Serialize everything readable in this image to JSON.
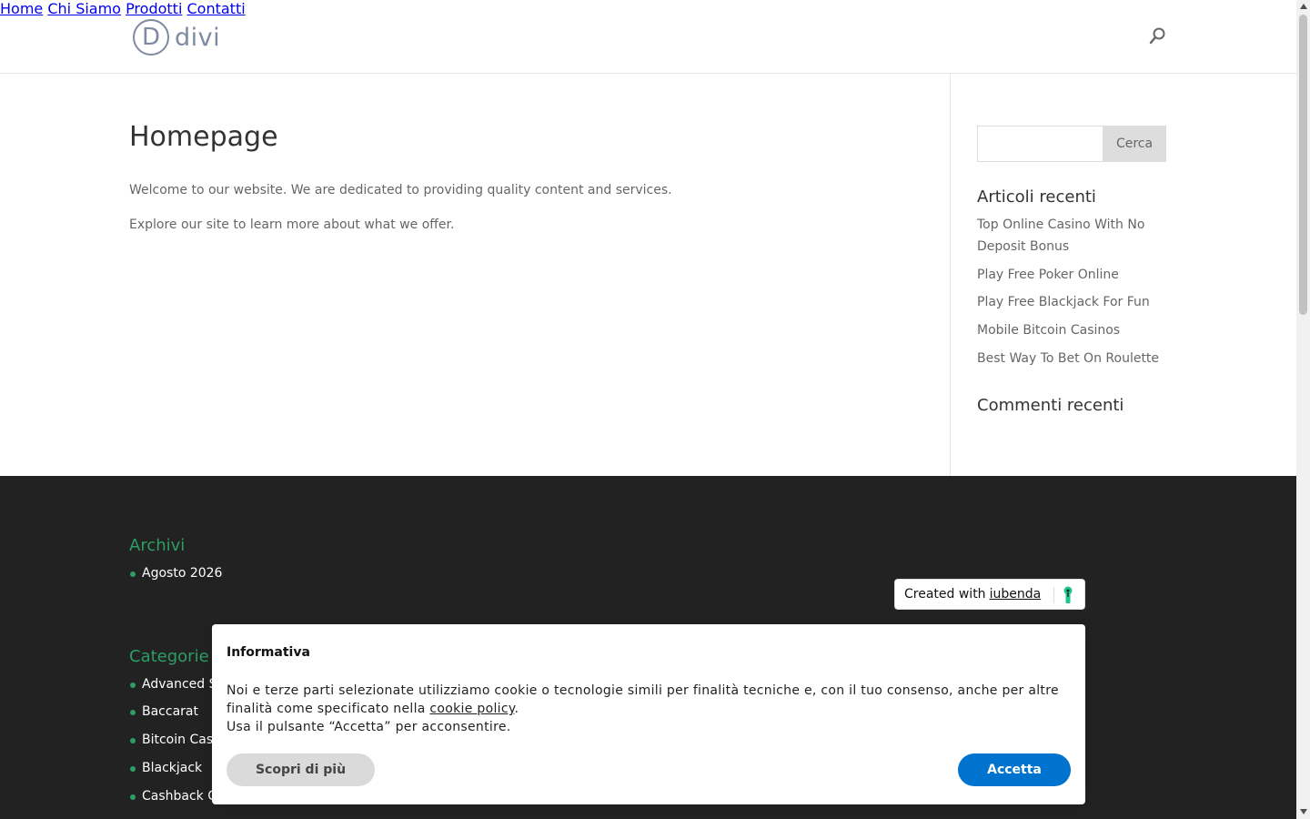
{
  "header": {
    "logo_letter": "D",
    "logo_text": "divi",
    "nav": [
      {
        "label": "Home"
      },
      {
        "label": "Chi Siamo"
      },
      {
        "label": "Prodotti"
      },
      {
        "label": "Contatti"
      }
    ],
    "search_icon": "search-icon"
  },
  "main": {
    "title": "Homepage",
    "paragraphs": [
      "Welcome to our website. We are dedicated to providing quality content and services.",
      "Explore our site to learn more about what we offer."
    ]
  },
  "sidebar": {
    "search_button": "Cerca",
    "search_value": "",
    "recent_posts_title": "Articoli recenti",
    "recent_posts": [
      "Top Online Casino With No Deposit Bonus",
      "Play Free Poker Online",
      "Play Free Blackjack For Fun",
      "Mobile Bitcoin Casinos",
      "Best Way To Bet On Roulette"
    ],
    "recent_comments_title": "Commenti recenti"
  },
  "footer": {
    "archives_title": "Archivi",
    "archives": [
      "Agosto 2026"
    ],
    "categories_title": "Categorie",
    "categories": [
      "Advanced St",
      "Baccarat",
      "Bitcoin Casi",
      "Blackjack",
      "Cashback C"
    ]
  },
  "iubenda_badge": {
    "prefix": "Created with",
    "link": "iubenda",
    "icon": "iubenda-keyhole-icon"
  },
  "cookie_banner": {
    "title": "Informativa",
    "text_before_link": "Noi e terze parti selezionate utilizziamo cookie o tecnologie simili per finalità tecniche e, con il tuo consenso, anche per altre finalità come specificato nella ",
    "link": "cookie policy",
    "text_after_link": ".",
    "line2": "Usa il pulsante “Accetta” per acconsentire.",
    "more_button": "Scopri di più",
    "accept_button": "Accetta"
  },
  "colors": {
    "accent_green": "#2c9e63",
    "footer_bg": "#222222",
    "accept_blue": "#0073CE",
    "iubenda_green": "#1CC691"
  }
}
